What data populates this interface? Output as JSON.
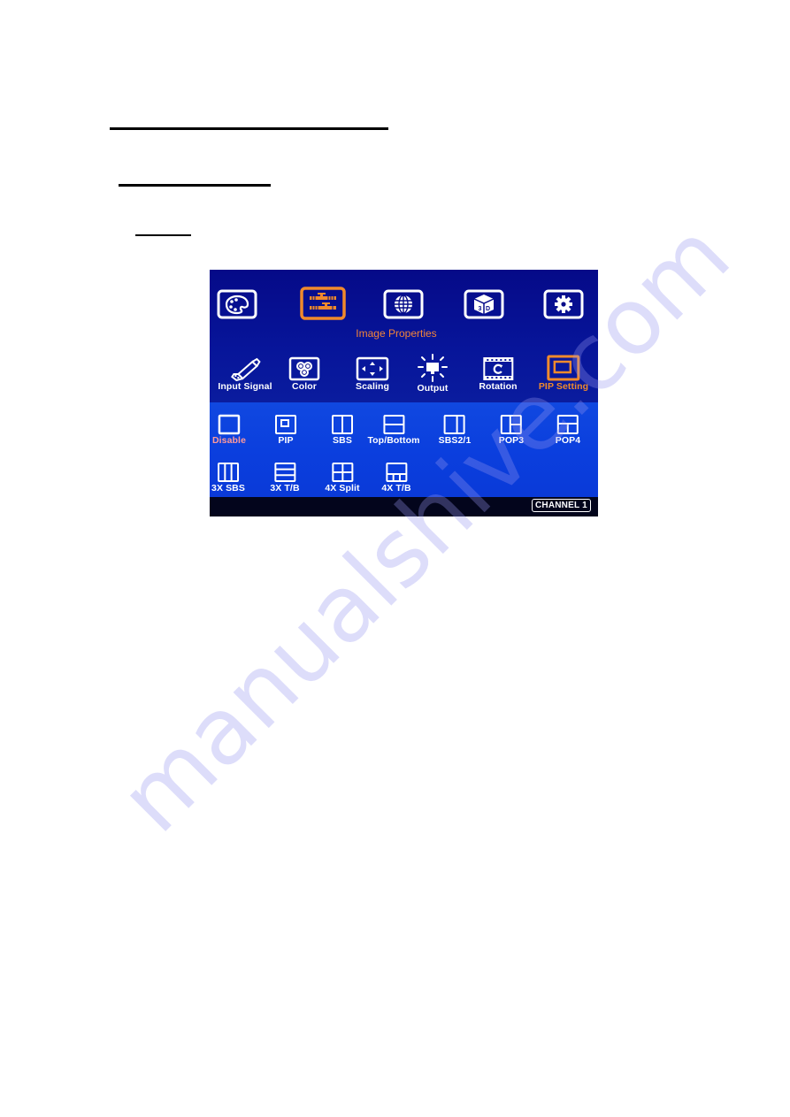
{
  "document": {
    "headings": [
      "",
      "",
      ""
    ]
  },
  "osd": {
    "category_title": "Image Properties",
    "top_menu": [
      {
        "name": "palette-icon",
        "active": false
      },
      {
        "name": "image-properties-icon",
        "active": true
      },
      {
        "name": "globe-icon",
        "active": false
      },
      {
        "name": "3d-cube-icon",
        "active": false
      },
      {
        "name": "gear-icon",
        "active": false
      }
    ],
    "sub_menu": [
      {
        "label": "Input Signal",
        "icon": "usb-plug-icon",
        "active": false
      },
      {
        "label": "Color",
        "icon": "color-circles-icon",
        "active": false
      },
      {
        "label": "Scaling",
        "icon": "scaling-arrows-icon",
        "active": false
      },
      {
        "label": "Output",
        "icon": "output-monitor-icon",
        "active": false
      },
      {
        "label": "Rotation",
        "icon": "rotation-film-icon",
        "active": false
      },
      {
        "label": "PIP Setting",
        "icon": "pip-window-icon",
        "active": true
      }
    ],
    "pip_modes": [
      {
        "label": "Disable",
        "icon": "disable-layout-icon",
        "selected": true
      },
      {
        "label": "PIP",
        "icon": "pip-layout-icon",
        "selected": false
      },
      {
        "label": "SBS",
        "icon": "sbs-layout-icon",
        "selected": false
      },
      {
        "label": "Top/Bottom",
        "icon": "top-bottom-layout-icon",
        "selected": false
      },
      {
        "label": "SBS2/1",
        "icon": "sbs2-1-layout-icon",
        "selected": false
      },
      {
        "label": "POP3",
        "icon": "pop3-layout-icon",
        "selected": false
      },
      {
        "label": "POP4",
        "icon": "pop4-layout-icon",
        "selected": false
      },
      {
        "label": "3X SBS",
        "icon": "3x-sbs-layout-icon",
        "selected": false
      },
      {
        "label": "3X T/B",
        "icon": "3x-tb-layout-icon",
        "selected": false
      },
      {
        "label": "4X Split",
        "icon": "4x-split-layout-icon",
        "selected": false
      },
      {
        "label": "4X T/B",
        "icon": "4x-tb-layout-icon",
        "selected": false
      }
    ],
    "channel_badge": "CHANNEL 1",
    "colors": {
      "active_accent": "#f08a2c",
      "selected_label": "#ff9a9a",
      "top_background": "#07159a",
      "mode_background": "#0b3fde",
      "status_bar": "#03051c"
    }
  },
  "watermark": "manualshive.com"
}
